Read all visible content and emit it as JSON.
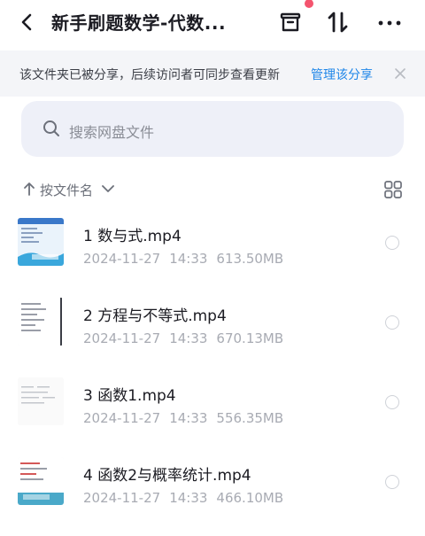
{
  "header": {
    "title": "新手刷题数学-代数...",
    "has_notification_dot": true
  },
  "banner": {
    "text": "该文件夹已被分享，后续访问者可同步查看更新",
    "link": "管理该分享"
  },
  "search": {
    "placeholder": "搜索网盘文件"
  },
  "sort": {
    "label": "按文件名"
  },
  "files": [
    {
      "name": "1 数与式.mp4",
      "date": "2024-11-27",
      "time": "14:33",
      "size": "613.50MB"
    },
    {
      "name": "2 方程与不等式.mp4",
      "date": "2024-11-27",
      "time": "14:33",
      "size": "670.13MB"
    },
    {
      "name": "3 函数1.mp4",
      "date": "2024-11-27",
      "time": "14:33",
      "size": "556.35MB"
    },
    {
      "name": "4 函数2与概率统计.mp4",
      "date": "2024-11-27",
      "time": "14:33",
      "size": "466.10MB"
    }
  ],
  "colors": {
    "accent": "#1f86e8",
    "notification_dot": "#f4546e",
    "search_bg": "#eef0f8",
    "banner_bg": "#f4f5f8"
  }
}
